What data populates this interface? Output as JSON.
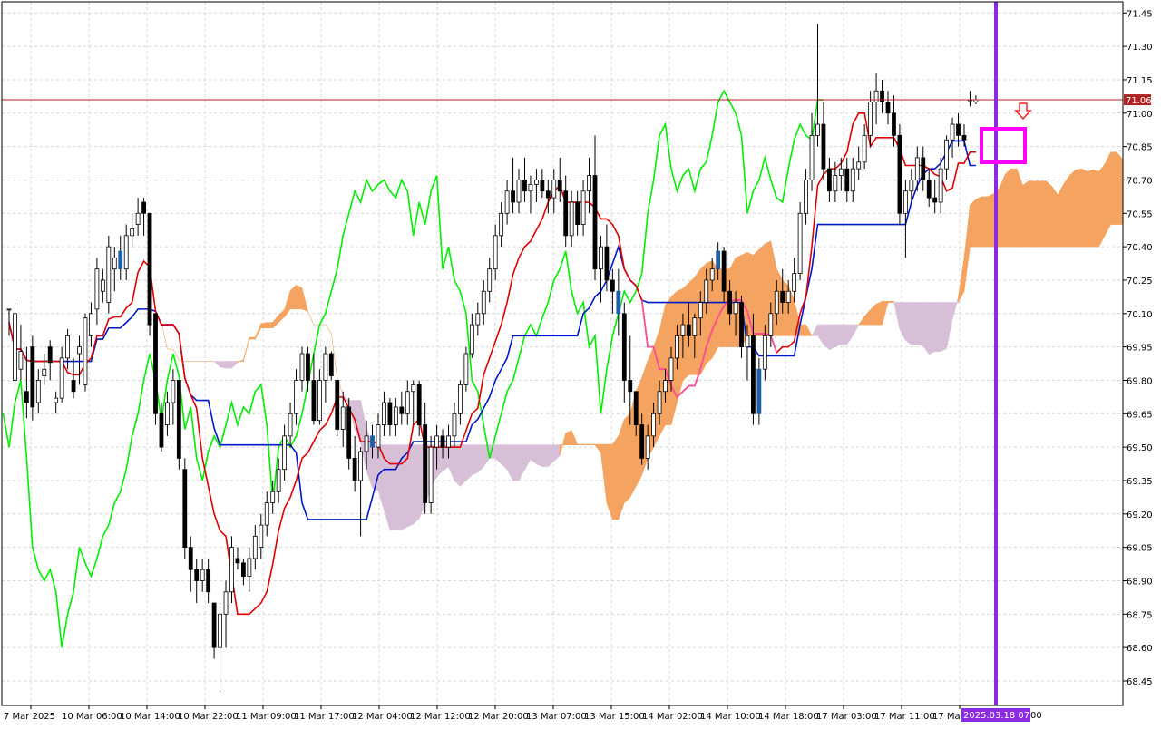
{
  "chart_data": {
    "type": "candlestick",
    "title": "",
    "price_axis": {
      "ticks": [
        "71.45",
        "71.30",
        "71.15",
        "71.00",
        "70.85",
        "70.70",
        "70.55",
        "70.40",
        "70.25",
        "70.10",
        "69.95",
        "69.80",
        "69.65",
        "69.50",
        "69.35",
        "69.20",
        "69.05",
        "68.90",
        "68.75",
        "68.60",
        "68.45"
      ],
      "ylim": [
        68.34,
        71.5
      ]
    },
    "time_axis": {
      "labels": [
        "7 Mar 2025",
        "10 Mar 06:00",
        "10 Mar 14:00",
        "10 Mar 22:00",
        "11 Mar 09:00",
        "11 Mar 17:00",
        "12 Mar 04:00",
        "12 Mar 12:00",
        "12 Mar 20:00",
        "13 Mar 07:00",
        "13 Mar 15:00",
        "14 Mar 02:00",
        "14 Mar 10:00",
        "14 Mar 18:00",
        "17 Mar 03:00",
        "17 Mar 11:00",
        "17 Mar"
      ],
      "highlight_label": "2025.03.18 07:00",
      "highlight_tail": "00"
    },
    "current_price": "71.06",
    "colors": {
      "bull": "#ffffff",
      "bear": "#000000",
      "wick": "#000000",
      "tenkan": "#e00000",
      "kijun": "#0018c8",
      "chikou": "#00ee00",
      "kumo_up": "#f4a460",
      "kumo_down": "#d8bfd8",
      "price_line": "#b22222",
      "vline": "#8a2be2",
      "magenta": "#ff00ff",
      "arrow": "#ff2020",
      "pink_line": "#ff4fa0",
      "highlight_candle": "#1f5fa8",
      "grid": "#d6d6d6"
    },
    "candles": [
      [
        70.12,
        70.12,
        70.0,
        70.12
      ],
      [
        69.8,
        70.15,
        69.73,
        70.1
      ],
      [
        69.85,
        70.05,
        69.8,
        69.93
      ],
      [
        69.75,
        69.95,
        69.63,
        69.7
      ],
      [
        69.95,
        70.0,
        69.62,
        69.68
      ],
      [
        69.7,
        69.85,
        69.65,
        69.8
      ],
      [
        69.82,
        69.92,
        69.78,
        69.85
      ],
      [
        69.95,
        69.98,
        69.8,
        69.88
      ],
      [
        69.7,
        69.75,
        69.65,
        69.72
      ],
      [
        69.72,
        69.95,
        69.7,
        69.9
      ],
      [
        69.9,
        70.03,
        69.85,
        70.0
      ],
      [
        69.8,
        69.9,
        69.72,
        69.75
      ],
      [
        69.92,
        70.0,
        69.78,
        69.95
      ],
      [
        69.78,
        70.1,
        69.75,
        70.08
      ],
      [
        70.0,
        70.15,
        69.95,
        70.1
      ],
      [
        70.12,
        70.35,
        70.05,
        70.3
      ],
      [
        70.2,
        70.3,
        70.15,
        70.25
      ],
      [
        70.15,
        70.45,
        70.1,
        70.4
      ],
      [
        70.3,
        70.4,
        70.2,
        70.35
      ],
      [
        70.38,
        70.45,
        70.25,
        70.3
      ],
      [
        70.3,
        70.5,
        70.25,
        70.45
      ],
      [
        70.45,
        70.55,
        70.4,
        70.48
      ],
      [
        70.5,
        70.62,
        70.45,
        70.55
      ],
      [
        70.6,
        70.62,
        70.45,
        70.55
      ],
      [
        70.55,
        70.55,
        70.0,
        70.05
      ],
      [
        70.1,
        70.1,
        69.6,
        69.65
      ],
      [
        69.65,
        69.7,
        69.48,
        69.5
      ],
      [
        69.6,
        69.75,
        69.55,
        69.7
      ],
      [
        69.7,
        69.85,
        69.6,
        69.8
      ],
      [
        69.8,
        69.8,
        69.4,
        69.45
      ],
      [
        69.4,
        69.45,
        69.0,
        69.05
      ],
      [
        69.05,
        69.1,
        68.85,
        68.95
      ],
      [
        68.95,
        69.0,
        68.8,
        68.9
      ],
      [
        68.9,
        69.0,
        68.85,
        68.95
      ],
      [
        68.95,
        69.0,
        68.8,
        68.85
      ],
      [
        68.8,
        68.8,
        68.55,
        68.6
      ],
      [
        68.6,
        68.8,
        68.4,
        68.75
      ],
      [
        68.75,
        68.9,
        68.6,
        68.85
      ],
      [
        68.85,
        69.1,
        68.8,
        69.05
      ],
      [
        69.0,
        69.05,
        68.95,
        68.98
      ],
      [
        68.98,
        69.0,
        68.88,
        68.92
      ],
      [
        68.92,
        69.05,
        68.85,
        69.0
      ],
      [
        69.0,
        69.15,
        68.95,
        69.1
      ],
      [
        69.05,
        69.2,
        69.0,
        69.15
      ],
      [
        69.15,
        69.3,
        69.1,
        69.25
      ],
      [
        69.25,
        69.35,
        69.2,
        69.3
      ],
      [
        69.3,
        69.45,
        69.25,
        69.4
      ],
      [
        69.4,
        69.6,
        69.35,
        69.55
      ],
      [
        69.55,
        69.7,
        69.5,
        69.65
      ],
      [
        69.65,
        69.85,
        69.6,
        69.8
      ],
      [
        69.8,
        69.95,
        69.75,
        69.92
      ],
      [
        69.92,
        69.95,
        69.75,
        69.8
      ],
      [
        69.8,
        69.92,
        69.6,
        69.62
      ],
      [
        69.62,
        69.85,
        69.6,
        69.8
      ],
      [
        69.8,
        69.95,
        69.7,
        69.92
      ],
      [
        69.92,
        69.93,
        69.8,
        69.82
      ],
      [
        69.8,
        69.8,
        69.55,
        69.58
      ],
      [
        69.58,
        69.75,
        69.5,
        69.68
      ],
      [
        69.68,
        69.72,
        69.4,
        69.45
      ],
      [
        69.45,
        69.55,
        69.3,
        69.35
      ],
      [
        69.35,
        69.5,
        69.1,
        69.48
      ],
      [
        69.48,
        69.62,
        69.4,
        69.55
      ],
      [
        69.55,
        69.6,
        69.45,
        69.5
      ],
      [
        69.5,
        69.65,
        69.45,
        69.6
      ],
      [
        69.6,
        69.75,
        69.55,
        69.7
      ],
      [
        69.7,
        69.72,
        69.55,
        69.6
      ],
      [
        69.6,
        69.72,
        69.55,
        69.68
      ],
      [
        69.68,
        69.75,
        69.6,
        69.65
      ],
      [
        69.65,
        69.8,
        69.6,
        69.75
      ],
      [
        69.75,
        69.8,
        69.6,
        69.78
      ],
      [
        69.78,
        69.8,
        69.55,
        69.6
      ],
      [
        69.6,
        69.7,
        69.2,
        69.25
      ],
      [
        69.25,
        69.55,
        69.2,
        69.5
      ],
      [
        69.5,
        69.6,
        69.4,
        69.55
      ],
      [
        69.55,
        69.58,
        69.45,
        69.5
      ],
      [
        69.5,
        69.6,
        69.45,
        69.55
      ],
      [
        69.55,
        69.7,
        69.5,
        69.65
      ],
      [
        69.65,
        69.8,
        69.6,
        69.78
      ],
      [
        69.78,
        69.95,
        69.75,
        69.92
      ],
      [
        69.92,
        70.1,
        69.9,
        70.05
      ],
      [
        70.05,
        70.15,
        70.0,
        70.1
      ],
      [
        70.1,
        70.25,
        70.05,
        70.2
      ],
      [
        70.2,
        70.35,
        70.15,
        70.3
      ],
      [
        70.3,
        70.5,
        70.25,
        70.45
      ],
      [
        70.45,
        70.6,
        70.4,
        70.55
      ],
      [
        70.55,
        70.7,
        70.5,
        70.65
      ],
      [
        70.65,
        70.8,
        70.55,
        70.6
      ],
      [
        70.6,
        70.75,
        70.55,
        70.7
      ],
      [
        70.7,
        70.8,
        70.6,
        70.65
      ],
      [
        70.65,
        70.72,
        70.55,
        70.68
      ],
      [
        70.68,
        70.75,
        70.6,
        70.7
      ],
      [
        70.7,
        70.75,
        70.62,
        70.65
      ],
      [
        70.65,
        70.7,
        70.55,
        70.62
      ],
      [
        70.62,
        70.75,
        70.55,
        70.7
      ],
      [
        70.7,
        70.8,
        70.6,
        70.65
      ],
      [
        70.65,
        70.72,
        70.4,
        70.45
      ],
      [
        70.45,
        70.65,
        70.4,
        70.6
      ],
      [
        70.6,
        70.65,
        70.45,
        70.5
      ],
      [
        70.5,
        70.7,
        70.45,
        70.65
      ],
      [
        70.65,
        70.8,
        70.55,
        70.72
      ],
      [
        70.72,
        70.9,
        70.25,
        70.3
      ],
      [
        70.3,
        70.45,
        70.15,
        70.4
      ],
      [
        70.4,
        70.5,
        70.2,
        70.25
      ],
      [
        70.25,
        70.3,
        70.1,
        70.2
      ],
      [
        70.2,
        70.3,
        70.0,
        70.1
      ],
      [
        70.1,
        70.15,
        69.7,
        69.8
      ],
      [
        69.8,
        70.0,
        69.6,
        69.75
      ],
      [
        69.75,
        69.75,
        69.55,
        69.6
      ],
      [
        69.6,
        69.65,
        69.42,
        69.45
      ],
      [
        69.45,
        69.6,
        69.4,
        69.55
      ],
      [
        69.55,
        69.7,
        69.5,
        69.65
      ],
      [
        69.65,
        69.8,
        69.6,
        69.75
      ],
      [
        69.75,
        69.85,
        69.7,
        69.8
      ],
      [
        69.8,
        69.95,
        69.75,
        69.9
      ],
      [
        69.9,
        70.05,
        69.85,
        70.0
      ],
      [
        70.0,
        70.1,
        69.9,
        70.05
      ],
      [
        70.05,
        70.15,
        69.95,
        70.0
      ],
      [
        70.0,
        70.1,
        69.9,
        70.08
      ],
      [
        70.08,
        70.2,
        70.0,
        70.15
      ],
      [
        70.15,
        70.3,
        70.1,
        70.25
      ],
      [
        70.25,
        70.35,
        70.2,
        70.3
      ],
      [
        70.3,
        70.42,
        70.25,
        70.38
      ],
      [
        70.38,
        70.4,
        70.15,
        70.2
      ],
      [
        70.2,
        70.25,
        70.05,
        70.1
      ],
      [
        70.1,
        70.2,
        70.0,
        70.15
      ],
      [
        70.15,
        70.18,
        69.9,
        69.95
      ],
      [
        69.95,
        70.05,
        69.8,
        70.0
      ],
      [
        70.0,
        70.1,
        69.6,
        69.65
      ],
      [
        69.65,
        69.9,
        69.6,
        69.85
      ],
      [
        69.85,
        70.05,
        69.8,
        70.0
      ],
      [
        70.0,
        70.15,
        69.95,
        70.1
      ],
      [
        70.1,
        70.25,
        70.05,
        70.2
      ],
      [
        70.2,
        70.3,
        70.1,
        70.15
      ],
      [
        70.15,
        70.25,
        70.1,
        70.2
      ],
      [
        70.2,
        70.35,
        70.15,
        70.28
      ],
      [
        70.28,
        70.6,
        70.25,
        70.55
      ],
      [
        70.55,
        70.75,
        70.5,
        70.7
      ],
      [
        70.7,
        71.0,
        70.65,
        70.9
      ],
      [
        70.9,
        71.4,
        70.85,
        70.95
      ],
      [
        70.95,
        71.05,
        70.7,
        70.75
      ],
      [
        70.75,
        70.8,
        70.6,
        70.65
      ],
      [
        70.65,
        70.78,
        70.6,
        70.72
      ],
      [
        70.72,
        70.8,
        70.65,
        70.75
      ],
      [
        70.75,
        70.8,
        70.6,
        70.65
      ],
      [
        70.65,
        70.8,
        70.6,
        70.75
      ],
      [
        70.75,
        70.85,
        70.7,
        70.78
      ],
      [
        70.78,
        70.95,
        70.75,
        70.9
      ],
      [
        70.9,
        71.1,
        70.85,
        71.05
      ],
      [
        71.05,
        71.18,
        70.95,
        71.1
      ],
      [
        71.1,
        71.15,
        71.0,
        71.05
      ],
      [
        71.05,
        71.1,
        70.95,
        71.0
      ],
      [
        71.0,
        71.08,
        70.85,
        70.9
      ],
      [
        70.9,
        70.95,
        70.5,
        70.55
      ],
      [
        70.55,
        70.7,
        70.35,
        70.65
      ],
      [
        70.65,
        70.75,
        70.6,
        70.7
      ],
      [
        70.7,
        70.85,
        70.65,
        70.8
      ],
      [
        70.8,
        70.85,
        70.65,
        70.7
      ],
      [
        70.7,
        70.75,
        70.58,
        70.62
      ],
      [
        70.62,
        70.7,
        70.55,
        70.6
      ],
      [
        70.6,
        70.8,
        70.55,
        70.75
      ],
      [
        70.75,
        70.9,
        70.7,
        70.88
      ],
      [
        70.88,
        70.98,
        70.8,
        70.95
      ],
      [
        70.95,
        71.0,
        70.85,
        70.9
      ],
      [
        70.9,
        70.95,
        70.85,
        70.88
      ],
      [
        71.06,
        71.1,
        71.03,
        71.06
      ],
      [
        71.05,
        71.08,
        71.04,
        71.06
      ]
    ]
  }
}
